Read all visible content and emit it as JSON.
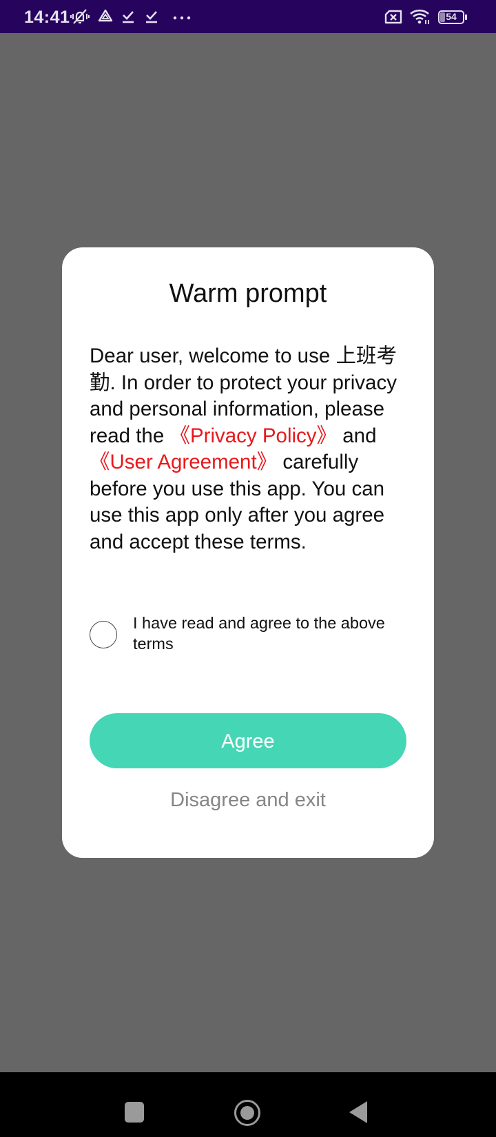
{
  "status_bar": {
    "time": "14:41",
    "icons": [
      "mute-vibrate-icon",
      "drive-icon",
      "download-done-icon",
      "download-done-icon",
      "more-notifications-icon",
      "no-sim-icon",
      "wifi-icon",
      "battery-icon"
    ],
    "battery_level": "54"
  },
  "dialog": {
    "title": "Warm prompt",
    "body": {
      "intro": "Dear user, welcome to use 上班考勤. In order to protect your privacy and personal information, please read the ",
      "privacy_link": "《Privacy Policy》",
      "and": " and ",
      "agreement_link": "《User Agreement》",
      "outro": " carefully before you use this app. You can use this app only after you agree and accept these terms."
    },
    "checkbox_label": "I have read and agree to the above terms",
    "checkbox_checked": false,
    "agree_label": "Agree",
    "disagree_label": "Disagree and exit"
  },
  "colors": {
    "accent": "#45d6b5",
    "link": "#e8191c",
    "status_bar": "#26045e"
  },
  "nav_bar": {
    "buttons": [
      "recents-icon",
      "home-icon",
      "back-icon"
    ]
  }
}
